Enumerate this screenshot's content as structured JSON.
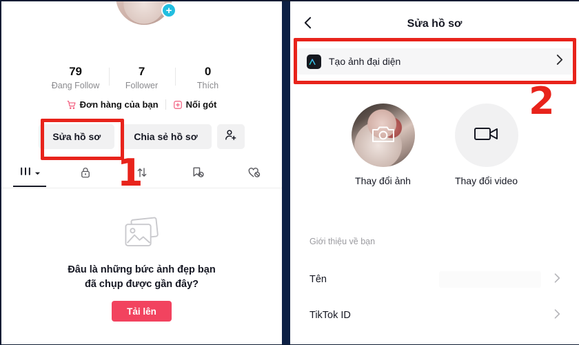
{
  "colors": {
    "accent_red": "#e8231b",
    "upload_pink": "#f2435f",
    "plus_badge_cyan": "#22bee0",
    "divider_navy": "#0d2044",
    "pill_grey": "#f1f1f2",
    "text_primary": "#161823",
    "text_muted": "#8a8a8e"
  },
  "left_panel": {
    "avatar": {
      "name": "profile-avatar",
      "badge": "plus-icon"
    },
    "stats": [
      {
        "value": "79",
        "label": "Đang Follow"
      },
      {
        "value": "7",
        "label": "Follower"
      },
      {
        "value": "0",
        "label": "Thích"
      }
    ],
    "meta": [
      {
        "icon": "cart-icon",
        "label": "Đơn hàng của bạn"
      },
      {
        "icon": "add-badge-icon",
        "label": "Nối gót"
      }
    ],
    "actions": {
      "edit_profile": "Sửa hồ sơ",
      "share_profile": "Chia sẻ hồ sơ",
      "add_friend_icon": "add-person-icon"
    },
    "tabs": [
      {
        "name": "grid-tab",
        "icon": "grid-dropdown-icon",
        "active": true
      },
      {
        "name": "private-tab",
        "icon": "lock-icon",
        "active": false
      },
      {
        "name": "repost-tab",
        "icon": "repost-icon",
        "active": false
      },
      {
        "name": "saved-tab",
        "icon": "bookmark-off-icon",
        "active": false
      },
      {
        "name": "liked-tab",
        "icon": "heart-off-icon",
        "active": false
      }
    ],
    "empty_state": {
      "icon": "photos-placeholder-icon",
      "title_line1": "Đâu là những bức ảnh đẹp bạn",
      "title_line2": "đã chụp được gần đây?",
      "upload_button": "Tải lên"
    }
  },
  "right_panel": {
    "back_icon": "chevron-left-icon",
    "title": "Sửa hồ sơ",
    "ai_row": {
      "badge_text": "AI",
      "label": "Tạo ảnh đại diện",
      "chevron": "chevron-right-icon"
    },
    "media": [
      {
        "label": "Thay đổi ảnh",
        "icon": "camera-icon"
      },
      {
        "label": "Thay đổi video",
        "icon": "video-camera-icon"
      }
    ],
    "section_label": "Giới thiệu về bạn",
    "rows": [
      {
        "label": "Tên",
        "chevron": "chevron-right-icon"
      },
      {
        "label": "TikTok ID",
        "chevron": "chevron-right-icon"
      }
    ]
  },
  "annotations": {
    "step_one": "1",
    "step_two": "2"
  }
}
